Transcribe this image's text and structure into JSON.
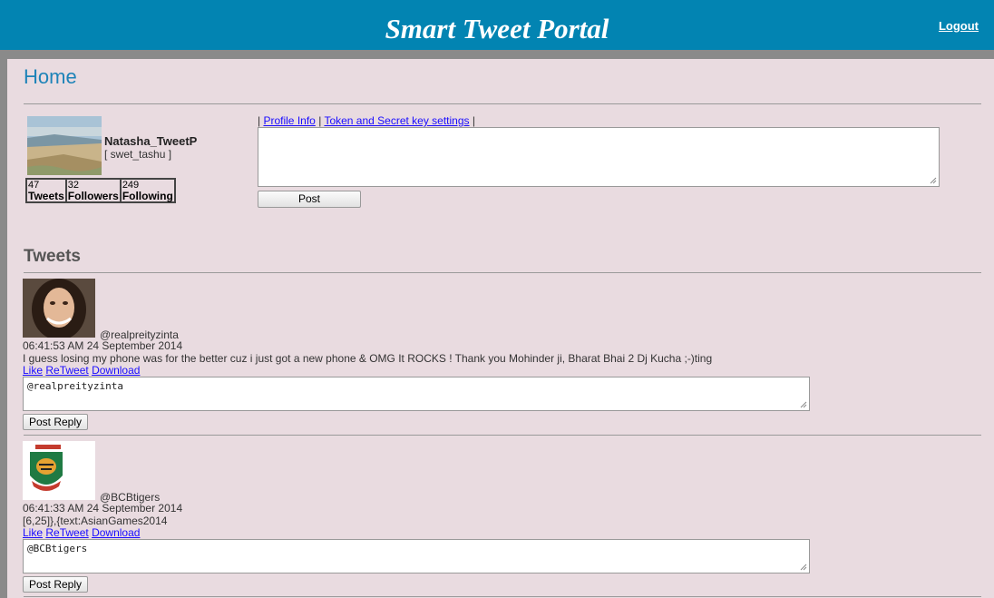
{
  "header": {
    "title": "Smart Tweet Portal",
    "logout": "Logout"
  },
  "page": {
    "heading": "Home"
  },
  "profile": {
    "name": "Natasha_TweetP",
    "handle": "[ swet_tashu ]",
    "stats": [
      {
        "count": "47",
        "label": "Tweets"
      },
      {
        "count": "32",
        "label": "Followers"
      },
      {
        "count": "249",
        "label": "Following"
      }
    ]
  },
  "composer": {
    "sep1": "|",
    "profile_info": "Profile Info",
    "sep2": "|",
    "token_settings": "Token and Secret key settings",
    "sep3": "|",
    "post_label": "Post"
  },
  "tweets_heading": "Tweets",
  "tweets": [
    {
      "handle": "@realpreityzinta",
      "time": "06:41:53 AM 24 September 2014",
      "text": "I guess losing my phone was for the better cuz i just got a new phone & OMG It ROCKS ! Thank you Mohinder ji, Bharat Bhai 2 Dj Kucha ;-)ting",
      "like": "Like",
      "retweet": "ReTweet",
      "download": "Download",
      "reply_value": "@realpreityzinta",
      "reply_label": "Post Reply"
    },
    {
      "handle": "@BCBtigers",
      "time": "06:41:33 AM 24 September 2014",
      "text": "[6,25]},{text:AsianGames2014",
      "like": "Like",
      "retweet": "ReTweet",
      "download": "Download",
      "reply_value": "@BCBtigers",
      "reply_label": "Post Reply"
    }
  ]
}
